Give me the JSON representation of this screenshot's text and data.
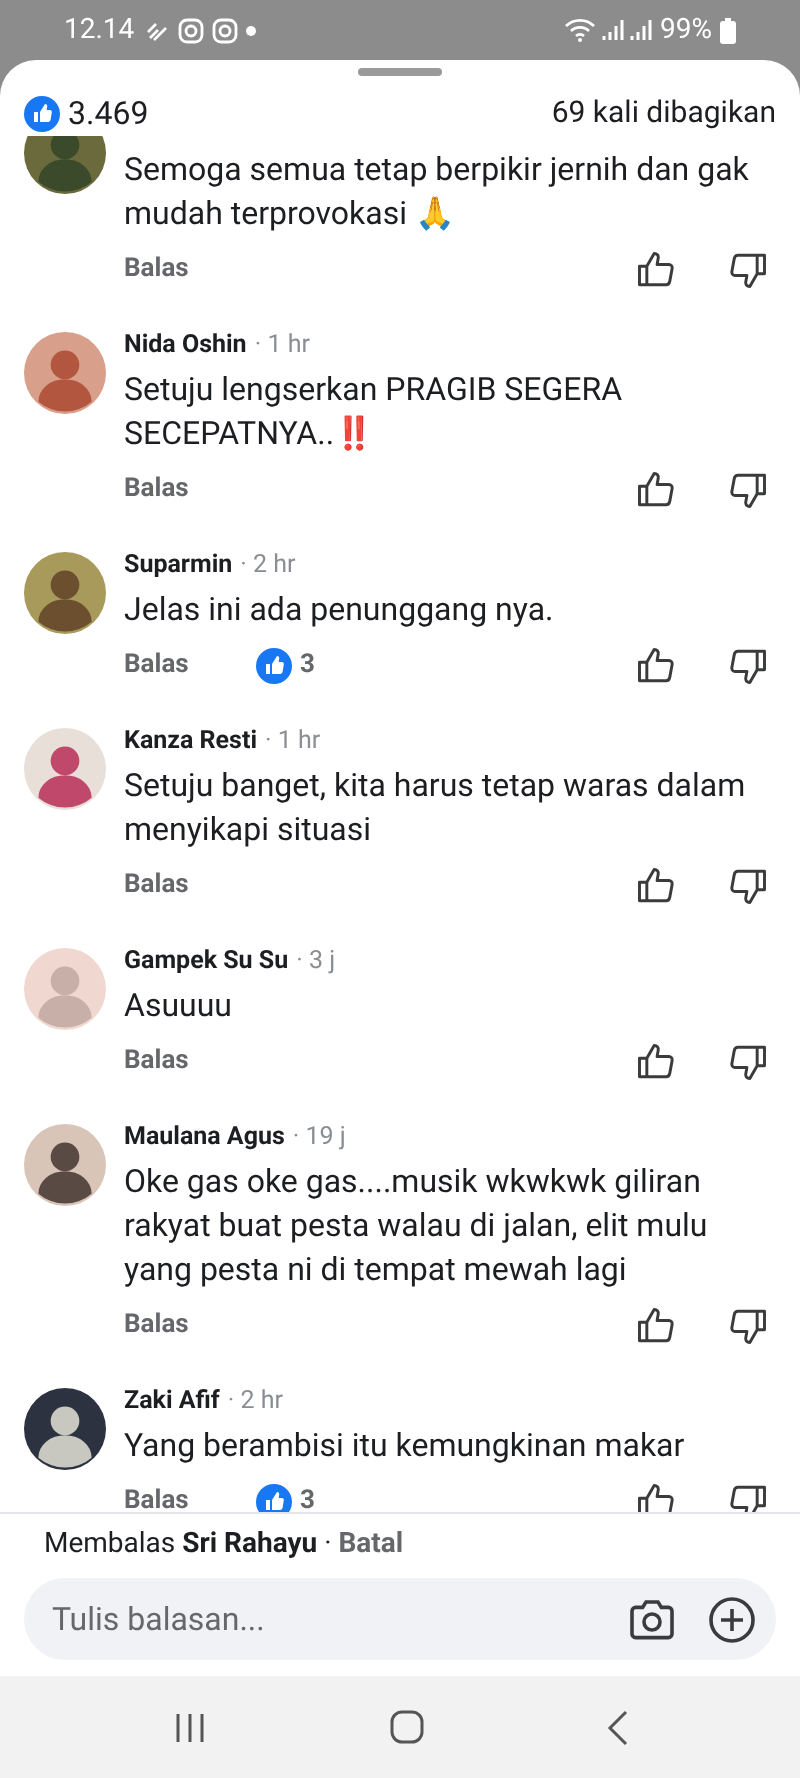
{
  "status_bar": {
    "time": "12.14",
    "battery": "99%"
  },
  "reactions": {
    "count": "3.469",
    "shares": "69 kali dibagikan"
  },
  "comments": [
    {
      "text": "Semoga semua tetap berpikir jernih dan gak mudah terprovokasi 🙏",
      "reply": "Balas"
    },
    {
      "name": "Nida Oshin",
      "time": "· 1 hr",
      "text": "Setuju lengserkan PRAGIB SEGERA SECEPATNYA..‼️",
      "reply": "Balas"
    },
    {
      "name": "Suparmin",
      "time": "· 2 hr",
      "text": "Jelas ini ada penunggang nya.",
      "reply": "Balas",
      "likes": "3"
    },
    {
      "name": "Kanza Resti",
      "time": "· 1 hr",
      "text": "Setuju banget, kita harus tetap waras dalam menyikapi situasi",
      "reply": "Balas"
    },
    {
      "name": "Gampek Su Su",
      "time": "· 3 j",
      "text": "Asuuuu",
      "reply": "Balas"
    },
    {
      "name": "Maulana Agus",
      "time": "· 19 j",
      "text": "Oke gas oke gas....musik wkwkwk giliran rakyat buat pesta walau di jalan, elit mulu yang pesta ni di tempat mewah lagi",
      "reply": "Balas"
    },
    {
      "name": "Zaki Afif",
      "time": "· 2 hr",
      "text": "Yang berambisi itu kemungkinan makar",
      "reply": "Balas",
      "likes": "3"
    }
  ],
  "reply_bar": {
    "label": "Membalas",
    "target": "Sri Rahayu",
    "separator": "·",
    "cancel": "Batal",
    "placeholder": "Tulis balasan..."
  }
}
